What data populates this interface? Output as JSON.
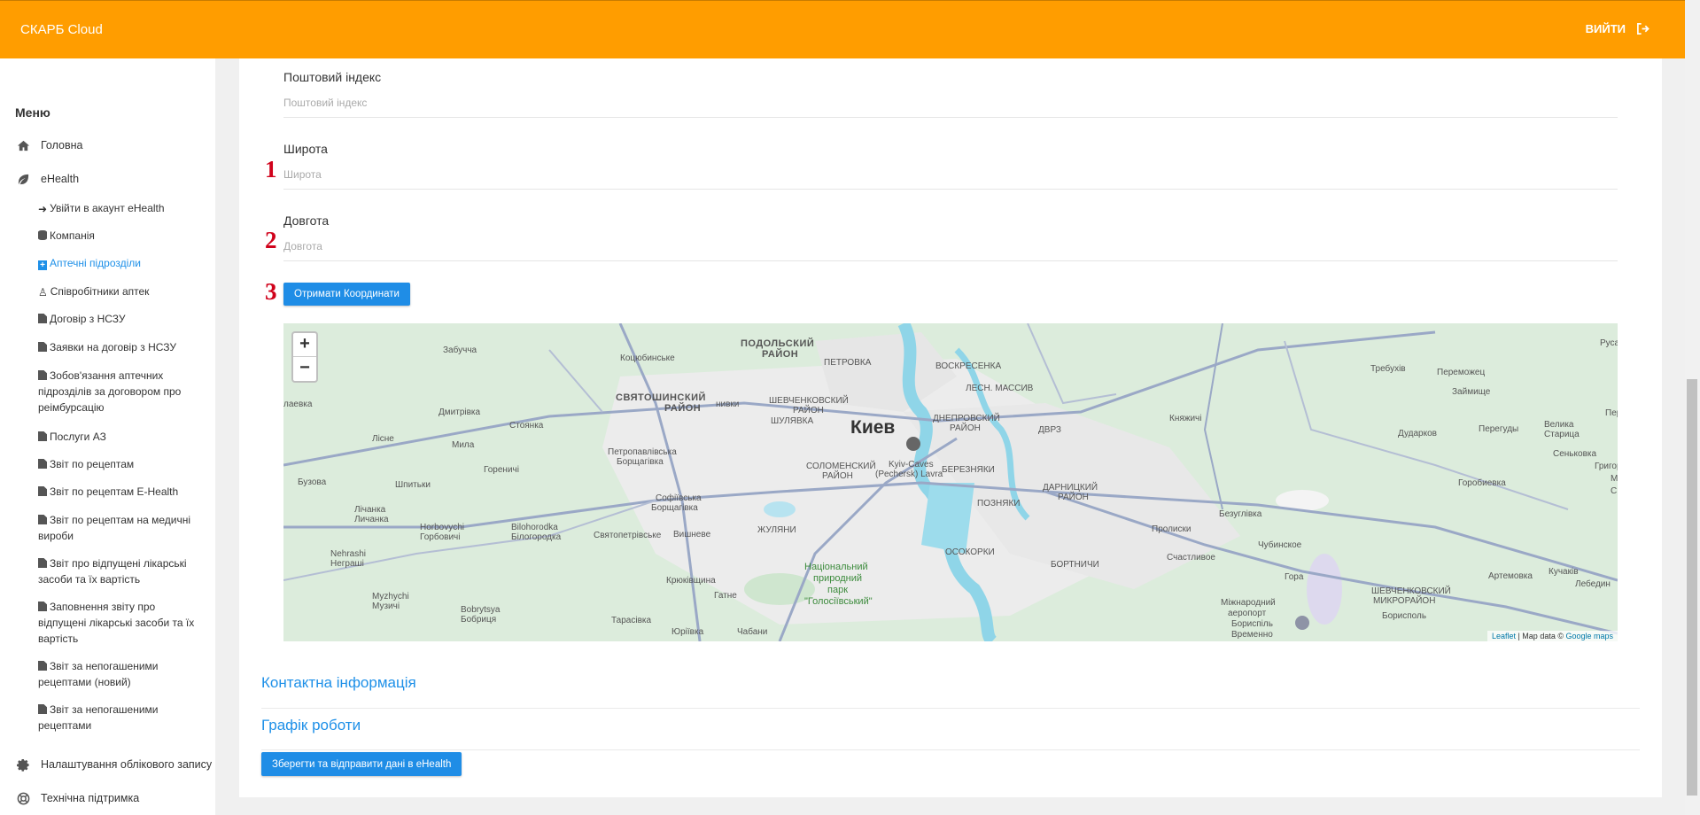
{
  "header": {
    "brand": "СКАРБ Cloud",
    "logout_label": "ВИЙТИ",
    "logout_icon": "sign-out-icon"
  },
  "sidebar": {
    "menu_title": "Меню",
    "main_items": [
      {
        "label": "Головна",
        "icon": "home-icon"
      },
      {
        "label": "eHealth",
        "icon": "leaf-icon"
      },
      {
        "label": "Налаштування облікового запису",
        "icon": "gear-icon"
      },
      {
        "label": "Технічна підтримка",
        "icon": "lifebuoy-icon"
      }
    ],
    "ehealth_items": [
      {
        "label": "Увійти в акаунт eHealth",
        "icon": "sign-in-icon"
      },
      {
        "label": "Компанія",
        "icon": "database-icon"
      },
      {
        "label": "Аптечні підрозділи",
        "icon": "plus-square-icon",
        "active": true
      },
      {
        "label": "Співробітники аптек",
        "icon": "user-md-icon"
      },
      {
        "label": "Договір з НСЗУ",
        "icon": "file-icon"
      },
      {
        "label": "Заявки на договір з НСЗУ",
        "icon": "file-icon"
      },
      {
        "label": "Зобов'язання аптечних підрозділів за договором про реімбурсацію",
        "icon": "file-icon"
      },
      {
        "label": "Послуги АЗ",
        "icon": "file-icon"
      },
      {
        "label": "Звіт по рецептам",
        "icon": "file-icon"
      },
      {
        "label": "Звіт по рецептам E-Health",
        "icon": "file-icon"
      },
      {
        "label": "Звіт по рецептам на медичні вироби",
        "icon": "file-icon"
      },
      {
        "label": "Звіт про відпущені лікарські засоби та їх вартість",
        "icon": "file-icon"
      },
      {
        "label": "Заповнення звіту про відпущені лікарські засоби та їх вартість",
        "icon": "file-icon"
      },
      {
        "label": "Звіт за непогашеними рецептами (новий)",
        "icon": "file-icon"
      },
      {
        "label": "Звіт за непогашеними рецептами",
        "icon": "file-icon"
      }
    ]
  },
  "form": {
    "postal": {
      "label": "Поштовий індекс",
      "placeholder": "Поштовий індекс",
      "value": ""
    },
    "latitude": {
      "label": "Широта",
      "placeholder": "Широта",
      "value": "",
      "marker": "1"
    },
    "longitude": {
      "label": "Довгота",
      "placeholder": "Довгота",
      "value": "",
      "marker": "2"
    },
    "get_coords": {
      "label": "Отримати Координати",
      "marker": "3"
    }
  },
  "map": {
    "zoom_in": "+",
    "zoom_out": "−",
    "attribution_leaflet": "Leaflet",
    "attribution_text": " | Map data © ",
    "attribution_google": "Google maps",
    "labels": [
      "Киев",
      "ПОДОЛЬСКИЙ",
      "РАЙОН",
      "СВЯТОШИНСКИЙ",
      "РАЙОН",
      "ПЕТРОВКА",
      "ВОСКРЕСЕНКА",
      "ЛЕСН. МАССИВ",
      "ШЕВЧЕНКОВСКИЙ",
      "РАЙОН",
      "ШУЛЯВКА",
      "ДНЕПРОВСКИЙ",
      "РАЙОН",
      "ДВРЗ",
      "СОЛОМЕНСКИЙ",
      "РАЙОН",
      "Kyiv-Caves",
      "(Pechersk) Lavra",
      "БЕРЕЗНЯКИ",
      "ДАРНИЦКИЙ",
      "РАЙОН",
      "ПОЗНЯКИ",
      "ЖУЛЯНИ",
      "ОСОКОРКИ",
      "БОРТНИЧИ",
      "Національний",
      "природний",
      "парк",
      "\"Голосіївський\"",
      "Коцюбинське",
      "Забучча",
      "Дмитрівка",
      "Стоянка",
      "Мила",
      "Лісне",
      "Гореничі",
      "Шпитьки",
      "Петропавлівська",
      "Борщагівка",
      "Софіївська",
      "Борщагівка",
      "Лічанка",
      "Личанка",
      "Horbovychi",
      "Горбовичі",
      "Bilohorodka",
      "Білогородка",
      "Святопетрівське",
      "Вишневе",
      "Крюківщина",
      "Гатне",
      "Тарасівка",
      "Юріївка",
      "Чабани",
      "Mуzhуchi",
      "Музичі",
      "Bobrytsya",
      "Бобриця",
      "Nehrashi",
      "Неграші",
      "Бузова",
      "лаевка",
      "нивки",
      "Княжичі",
      "Требухів",
      "Переможец",
      "Займище",
      "Дударков",
      "Перегуды",
      "Велика",
      "Старица",
      "Сеньковка",
      "Горобиевка",
      "Безуглівка",
      "Пролиски",
      "Чубинское",
      "Счастливое",
      "Гора",
      "ШЕВЧЕНКОВСКИЙ",
      "МИКРОРАЙОН",
      "Борисполь",
      "Артемовка",
      "Кучаків",
      "Лебедин",
      "Міжнародний",
      "аеропорт",
      "Бориспіль",
      "Временно",
      "Руса",
      "Пер",
      "Григорове",
      "М",
      "С"
    ]
  },
  "sections": {
    "contact": "Контактна інформація",
    "schedule": "Графік роботи"
  },
  "save_button": "Зберегти та відправити дані в eHealth"
}
